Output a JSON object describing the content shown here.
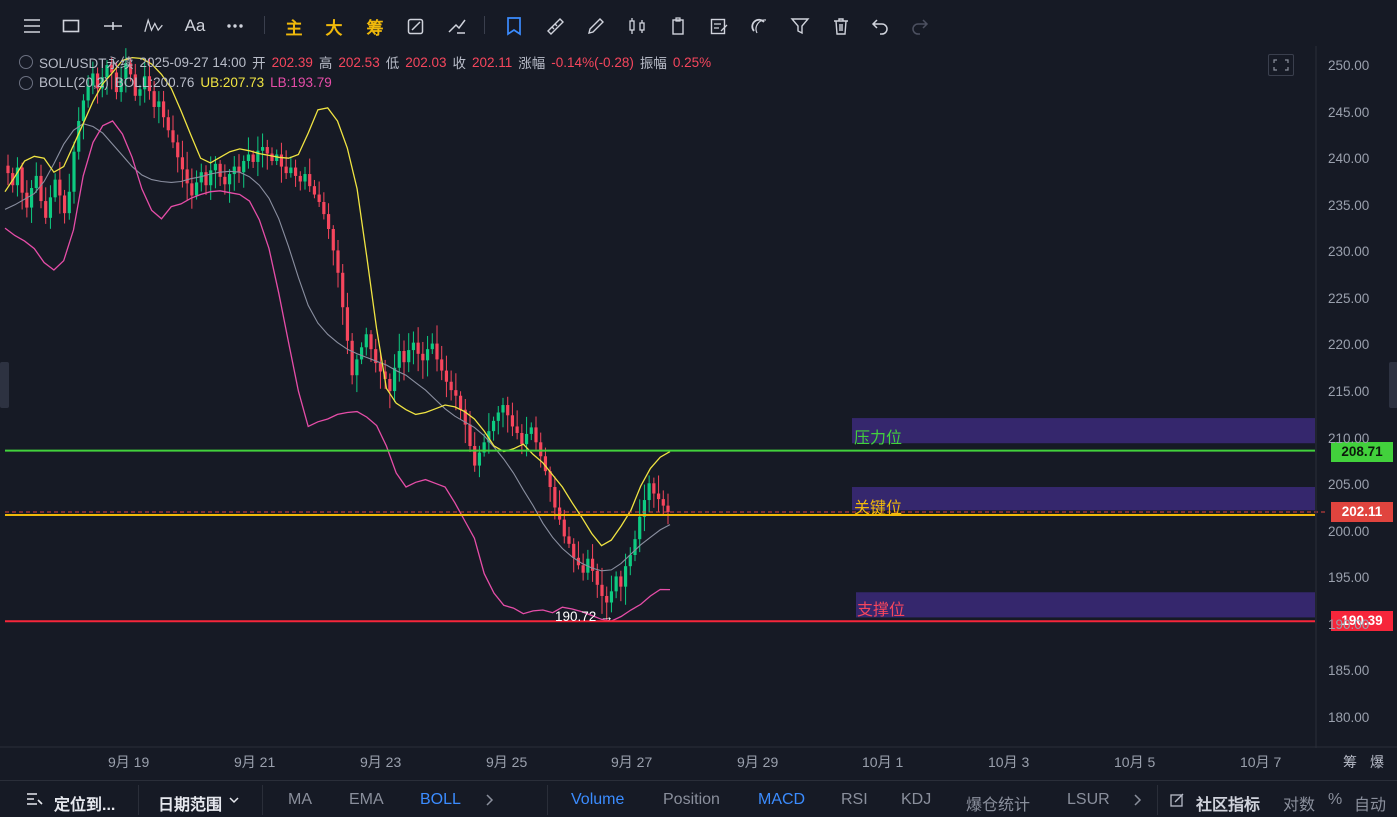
{
  "toolbar": {
    "main_label": "主",
    "big_label": "大",
    "chips_label": "筹",
    "text_tool_label": "Aa"
  },
  "header": {
    "symbol": "SOL/USDT永续",
    "datetime": "2025-09-27 14:00",
    "open_label": "开",
    "open_value": "202.39",
    "high_label": "高",
    "high_value": "202.53",
    "low_label": "低",
    "low_value": "202.03",
    "close_label": "收",
    "close_value": "202.11",
    "change_label": "涨幅",
    "change_value": "-0.14%(-0.28)",
    "amplitude_label": "振幅",
    "amplitude_value": "0.25%"
  },
  "boll": {
    "name": "BOLL(20,2)",
    "mid": "BOLL:200.76",
    "ub": "UB:207.73",
    "lb": "LB:193.79"
  },
  "levels": {
    "resistance_label": "压力位",
    "key_label": "关键位",
    "support_label": "支撑位",
    "resistance_price": "208.71",
    "current_price": "202.11",
    "support_price": "190.39",
    "low_marker": "190.72 →"
  },
  "colors": {
    "bg": "#161a25",
    "up": "#0ecb81",
    "down": "#f6465d",
    "ub": "#f0e442",
    "lb": "#e64da8",
    "mid": "#8a8fa0",
    "resistance": "#42d13c",
    "key": "#f0b90b",
    "support": "#f6263b",
    "zone": "#3b2a7a"
  },
  "chart_data": {
    "type": "candlestick",
    "title": "SOL/USDT永续",
    "ylim": [
      178,
      252
    ],
    "y_ticks": [
      "250.00",
      "245.00",
      "240.00",
      "235.00",
      "230.00",
      "225.00",
      "220.00",
      "215.00",
      "210.00",
      "205.00",
      "200.00",
      "195.00",
      "190.00",
      "185.00",
      "180.00"
    ],
    "x_ticks": [
      "9月 19",
      "9月 21",
      "9月 23",
      "9月 25",
      "9月 27",
      "9月 29",
      "10月 1",
      "10月 3",
      "10月 5",
      "10月 7"
    ],
    "horizontal_lines": [
      {
        "name": "压力位",
        "price": 208.71
      },
      {
        "name": "关键位",
        "price": 202.11
      },
      {
        "name": "支撑位",
        "price": 190.39
      }
    ],
    "zones": [
      {
        "name": "压力位",
        "from": 209.5,
        "to": 212.2
      },
      {
        "name": "关键位",
        "from": 202.3,
        "to": 204.8
      },
      {
        "name": "支撑位",
        "from": 190.8,
        "to": 193.5
      }
    ],
    "close_series": [
      238.5,
      237.2,
      239.1,
      236.4,
      234.8,
      236.9,
      238.2,
      235.5,
      233.7,
      235.9,
      237.8,
      236.1,
      234.2,
      236.5,
      240.8,
      244.1,
      246.3,
      247.9,
      249.2,
      247.6,
      248.8,
      250.1,
      249.3,
      247.2,
      248.6,
      250.3,
      249.1,
      246.8,
      247.5,
      248.9,
      247.3,
      245.6,
      246.2,
      244.5,
      243.1,
      241.8,
      240.2,
      238.9,
      237.4,
      236.1,
      237.5,
      238.6,
      237.2,
      238.8,
      239.5,
      238.1,
      237.3,
      238.4,
      239.2,
      238.6,
      239.8,
      240.5,
      239.7,
      240.9,
      241.3,
      240.6,
      239.8,
      240.5,
      239.2,
      238.5,
      239.1,
      238.2,
      237.6,
      238.4,
      237.1,
      236.2,
      235.4,
      234.1,
      232.5,
      230.2,
      227.8,
      224.1,
      220.5,
      216.8,
      218.5,
      219.8,
      221.2,
      219.6,
      218.1,
      217.2,
      216.4,
      215.1,
      217.6,
      219.4,
      218.2,
      219.5,
      220.3,
      219.1,
      218.4,
      219.6,
      220.2,
      218.5,
      217.3,
      216.1,
      215.2,
      214.6,
      213.1,
      211.5,
      209.2,
      207.1,
      208.5,
      209.6,
      210.8,
      211.9,
      212.8,
      213.6,
      212.5,
      211.3,
      210.6,
      209.4,
      210.5,
      211.2,
      209.6,
      208.1,
      206.5,
      204.8,
      202.6,
      201.3,
      199.5,
      198.7,
      197.2,
      196.4,
      195.6,
      197.1,
      195.8,
      194.3,
      193.1,
      192.4,
      193.6,
      195.2,
      194.1,
      196.3,
      197.5,
      199.2,
      201.6,
      203.4,
      205.2,
      204.1,
      203.5,
      202.8,
      202.11
    ],
    "ub_series": [
      236.5,
      238.1,
      239.8,
      240.3,
      240.1,
      238.6,
      239.2,
      241.5,
      243.8,
      246.2,
      248.1,
      249.3,
      250.6,
      250.9,
      250.8,
      250.2,
      249.1,
      247.6,
      245.2,
      242.6,
      240.1,
      239.6,
      240.2,
      240.8,
      241.1,
      240.9,
      240.6,
      240.4,
      240.2,
      240.1,
      240.5,
      242.8,
      245.3,
      245.5,
      244.1,
      241.2,
      236.8,
      229.5,
      221.8,
      215.4,
      213.8,
      213.1,
      212.6,
      212.8,
      213.2,
      213.6,
      213.4,
      212.9,
      212.1,
      210.8,
      209.2,
      208.6,
      208.9,
      209.4,
      208.3,
      207.4,
      206.1,
      204.8,
      203.1,
      201.5,
      199.8,
      198.5,
      199.1,
      200.6,
      202.3,
      204.9,
      206.8,
      208.0,
      208.6
    ],
    "mid_series": [
      234.6,
      235.1,
      235.7,
      236.3,
      237.6,
      239.5,
      241.6,
      243.1,
      243.8,
      243.5,
      242.8,
      241.6,
      240.4,
      239.2,
      238.3,
      237.8,
      237.6,
      237.5,
      237.6,
      237.9,
      238.1,
      238.4,
      238.6,
      238.7,
      238.6,
      238.1,
      237.2,
      235.8,
      233.6,
      230.6,
      227.3,
      224.3,
      222.4,
      221.2,
      220.3,
      219.6,
      219.1,
      218.7,
      218.3,
      217.9,
      217.3,
      216.8,
      216.0,
      215.2,
      214.2,
      213.2,
      212.4,
      211.8,
      211.2,
      210.3,
      209.1,
      207.8,
      206.3,
      204.5,
      202.8,
      200.9,
      199.4,
      198.2,
      197.3,
      196.6,
      196.1,
      195.8,
      195.9,
      196.6,
      197.6,
      198.6,
      199.4,
      200.2,
      200.76
    ],
    "lb_series": [
      232.6,
      231.8,
      231.2,
      230.4,
      228.9,
      228.1,
      229.1,
      232.4,
      238.2,
      241.8,
      243.6,
      244.1,
      242.7,
      240.2,
      236.8,
      234.5,
      233.6,
      234.9,
      235.2,
      235.8,
      236.2,
      236.5,
      236.6,
      236.4,
      236.2,
      235.5,
      233.5,
      230.4,
      225.6,
      220.3,
      215.1,
      211.3,
      211.8,
      212.1,
      212.6,
      212.8,
      212.9,
      212.3,
      211.4,
      209.2,
      206.3,
      204.8,
      205.3,
      205.6,
      205.2,
      204.8,
      203.1,
      201.2,
      199.3,
      195.5,
      193.4,
      192.1,
      191.8,
      191.2,
      191.5,
      191.6,
      191.3,
      191.9,
      191.7,
      191.4,
      191.0,
      190.6,
      190.4,
      190.9,
      191.6,
      192.2,
      193.1,
      193.8,
      193.79
    ]
  },
  "footer": {
    "locate_label": "定位到...",
    "date_range_label": "日期范围",
    "ma": "MA",
    "ema": "EMA",
    "boll": "BOLL",
    "volume": "Volume",
    "position": "Position",
    "macd": "MACD",
    "rsi": "RSI",
    "kdj": "KDJ",
    "liq": "爆仓统计",
    "lsur": "LSUR",
    "community": "社区指标",
    "log": "对数",
    "percent": "%",
    "auto": "自动",
    "chips_tab": "筹",
    "liq_tab": "爆"
  }
}
